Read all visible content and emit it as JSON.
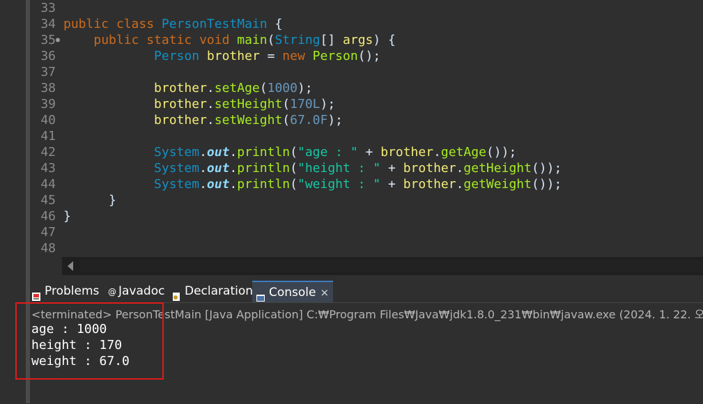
{
  "editor": {
    "lines": [
      {
        "n": "33",
        "tokens": []
      },
      {
        "n": "34",
        "tokens": [
          [
            "kw",
            "public class "
          ],
          [
            "cls",
            "PersonTestMain"
          ],
          [
            "plain",
            " {"
          ]
        ]
      },
      {
        "n": "35",
        "fold": true,
        "tokens": [
          [
            "plain",
            "    "
          ],
          [
            "kw",
            "public static void "
          ],
          [
            "fn",
            "main"
          ],
          [
            "plain",
            "("
          ],
          [
            "cls",
            "String"
          ],
          [
            "plain",
            "[] "
          ],
          [
            "var",
            "args"
          ],
          [
            "plain",
            ") {"
          ]
        ]
      },
      {
        "n": "36",
        "tokens": [
          [
            "plain",
            "            "
          ],
          [
            "cls",
            "Person"
          ],
          [
            "plain",
            " "
          ],
          [
            "var",
            "brother"
          ],
          [
            "plain",
            " = "
          ],
          [
            "kw",
            "new "
          ],
          [
            "fn",
            "Person"
          ],
          [
            "plain",
            "();"
          ]
        ]
      },
      {
        "n": "37",
        "tokens": []
      },
      {
        "n": "38",
        "tokens": [
          [
            "plain",
            "            "
          ],
          [
            "var",
            "brother"
          ],
          [
            "plain",
            "."
          ],
          [
            "fn",
            "setAge"
          ],
          [
            "plain",
            "("
          ],
          [
            "num",
            "1000"
          ],
          [
            "plain",
            ");"
          ]
        ]
      },
      {
        "n": "39",
        "tokens": [
          [
            "plain",
            "            "
          ],
          [
            "var",
            "brother"
          ],
          [
            "plain",
            "."
          ],
          [
            "fn",
            "setHeight"
          ],
          [
            "plain",
            "("
          ],
          [
            "num",
            "170L"
          ],
          [
            "plain",
            ");"
          ]
        ]
      },
      {
        "n": "40",
        "tokens": [
          [
            "plain",
            "            "
          ],
          [
            "var",
            "brother"
          ],
          [
            "plain",
            "."
          ],
          [
            "fn",
            "setWeight"
          ],
          [
            "plain",
            "("
          ],
          [
            "num",
            "67.0F"
          ],
          [
            "plain",
            ");"
          ]
        ]
      },
      {
        "n": "41",
        "tokens": []
      },
      {
        "n": "42",
        "tokens": [
          [
            "plain",
            "            "
          ],
          [
            "cls",
            "System"
          ],
          [
            "plain",
            "."
          ],
          [
            "fld",
            "out"
          ],
          [
            "plain",
            "."
          ],
          [
            "fn",
            "println"
          ],
          [
            "plain",
            "("
          ],
          [
            "str",
            "\"age : \""
          ],
          [
            "plain",
            " + "
          ],
          [
            "var",
            "brother"
          ],
          [
            "plain",
            "."
          ],
          [
            "fn",
            "getAge"
          ],
          [
            "plain",
            "());"
          ]
        ]
      },
      {
        "n": "43",
        "tokens": [
          [
            "plain",
            "            "
          ],
          [
            "cls",
            "System"
          ],
          [
            "plain",
            "."
          ],
          [
            "fld",
            "out"
          ],
          [
            "plain",
            "."
          ],
          [
            "fn",
            "println"
          ],
          [
            "plain",
            "("
          ],
          [
            "str",
            "\"height : \""
          ],
          [
            "plain",
            " + "
          ],
          [
            "var",
            "brother"
          ],
          [
            "plain",
            "."
          ],
          [
            "fn",
            "getHeight"
          ],
          [
            "plain",
            "());"
          ]
        ]
      },
      {
        "n": "44",
        "tokens": [
          [
            "plain",
            "            "
          ],
          [
            "cls",
            "System"
          ],
          [
            "plain",
            "."
          ],
          [
            "fld",
            "out"
          ],
          [
            "plain",
            "."
          ],
          [
            "fn",
            "println"
          ],
          [
            "plain",
            "("
          ],
          [
            "str",
            "\"weight : \""
          ],
          [
            "plain",
            " + "
          ],
          [
            "var",
            "brother"
          ],
          [
            "plain",
            "."
          ],
          [
            "fn",
            "getWeight"
          ],
          [
            "plain",
            "());"
          ]
        ]
      },
      {
        "n": "45",
        "tokens": [
          [
            "plain",
            "      }"
          ]
        ]
      },
      {
        "n": "46",
        "tokens": [
          [
            "plain",
            "}"
          ]
        ]
      },
      {
        "n": "47",
        "tokens": []
      },
      {
        "n": "48",
        "tokens": []
      }
    ]
  },
  "tabs": {
    "problems": "Problems",
    "javadoc": "Javadoc",
    "declaration": "Declaration",
    "console": "Console",
    "console_close": "×"
  },
  "console": {
    "terminated": "<terminated> PersonTestMain [Java Application] C:₩Program Files₩Java₩jdk1.8.0_231₩bin₩javaw.exe  (2024. 1. 22. 오",
    "output": [
      "age : 1000",
      "height : 170",
      "weight : 67.0"
    ]
  },
  "colors": {
    "highlight": "#e01b1b",
    "active_tab": "#3b4450"
  }
}
